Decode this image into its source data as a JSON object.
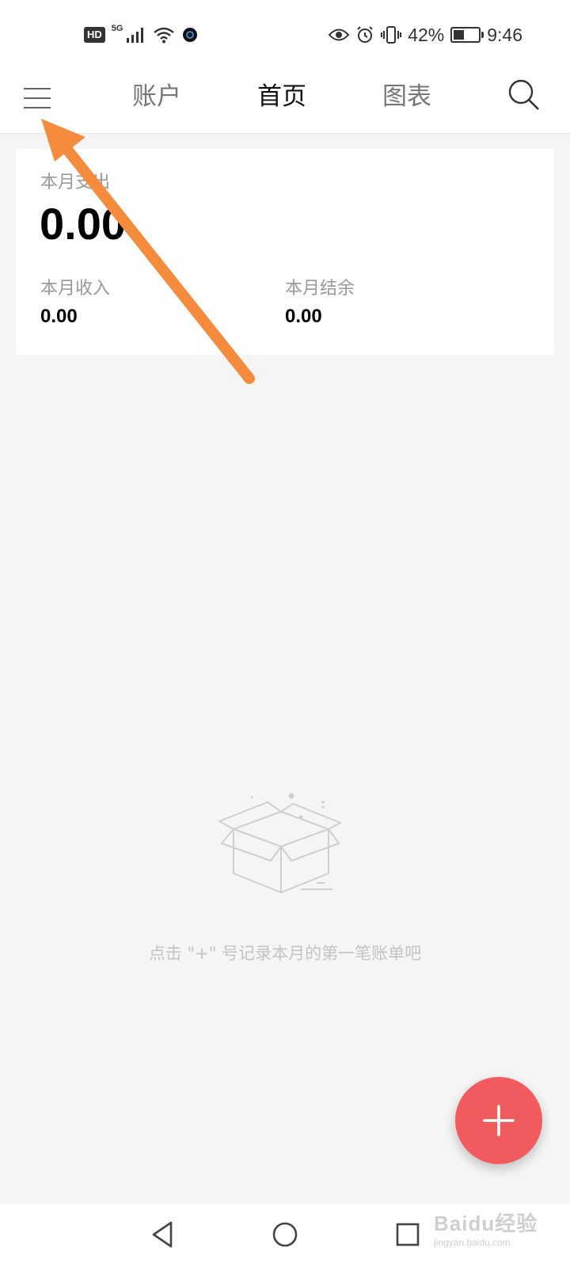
{
  "status_bar": {
    "hd_badge": "HD",
    "network": "5G",
    "battery_percent": "42%",
    "battery_level": 0.42,
    "time": "9:46",
    "icons": [
      "hd-icon",
      "signal-icon",
      "wifi-icon",
      "app-notification-icon",
      "eye-icon",
      "alarm-icon",
      "vibrate-icon",
      "battery-icon"
    ]
  },
  "header": {
    "tabs": [
      {
        "label": "账户",
        "active": false
      },
      {
        "label": "首页",
        "active": true
      },
      {
        "label": "图表",
        "active": false
      }
    ],
    "menu_icon": "hamburger-menu-icon",
    "search_icon": "search-icon"
  },
  "summary": {
    "expense_label": "本月支出",
    "expense_value": "0.00",
    "income_label": "本月收入",
    "income_value": "0.00",
    "balance_label": "本月结余",
    "balance_value": "0.00"
  },
  "empty_state": {
    "icon": "empty-box-icon",
    "hint": "点击 \"+\" 号记录本月的第一笔账单吧"
  },
  "fab": {
    "icon": "plus-icon",
    "color": "#f25b5e"
  },
  "annotation": {
    "color": "#f58b3c"
  },
  "nav_bar": {
    "icons": [
      "back-icon",
      "home-icon",
      "recents-icon"
    ]
  },
  "watermark": {
    "main": "Baidu经验",
    "sub": "jingyan.baidu.com"
  }
}
